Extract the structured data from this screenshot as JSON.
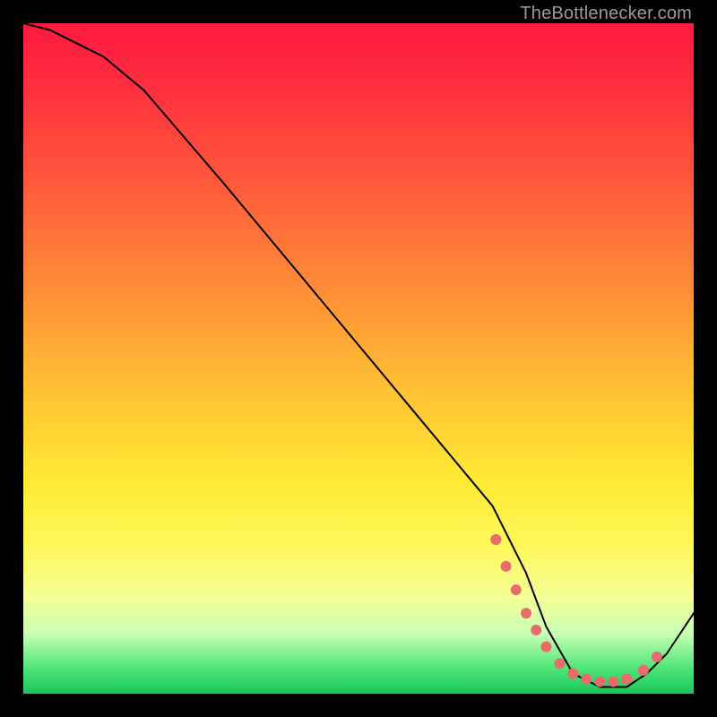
{
  "watermark": "TheBottlenecker.com",
  "chart_data": {
    "type": "line",
    "title": "",
    "xlabel": "",
    "ylabel": "",
    "x_range": [
      0,
      100
    ],
    "y_range": [
      0,
      100
    ],
    "series": [
      {
        "name": "curve",
        "stroke": "#000000",
        "stroke_width": 2,
        "x": [
          0,
          4,
          8,
          12,
          18,
          30,
          45,
          60,
          70,
          75,
          78,
          82,
          86,
          90,
          93,
          96,
          100
        ],
        "y": [
          100,
          99,
          97,
          95,
          90,
          76,
          58,
          40,
          28,
          18,
          10,
          3,
          1,
          1,
          3,
          6,
          12
        ]
      }
    ],
    "markers": {
      "name": "dots",
      "fill": "#e86c6c",
      "radius": 6,
      "x": [
        70.5,
        72,
        73.5,
        75,
        76.5,
        78,
        80,
        82,
        84,
        86,
        88,
        90,
        92.5,
        94.5
      ],
      "y": [
        23,
        19,
        15.5,
        12,
        9.5,
        7,
        4.5,
        3,
        2.2,
        1.8,
        1.8,
        2.2,
        3.5,
        5.5
      ]
    }
  }
}
